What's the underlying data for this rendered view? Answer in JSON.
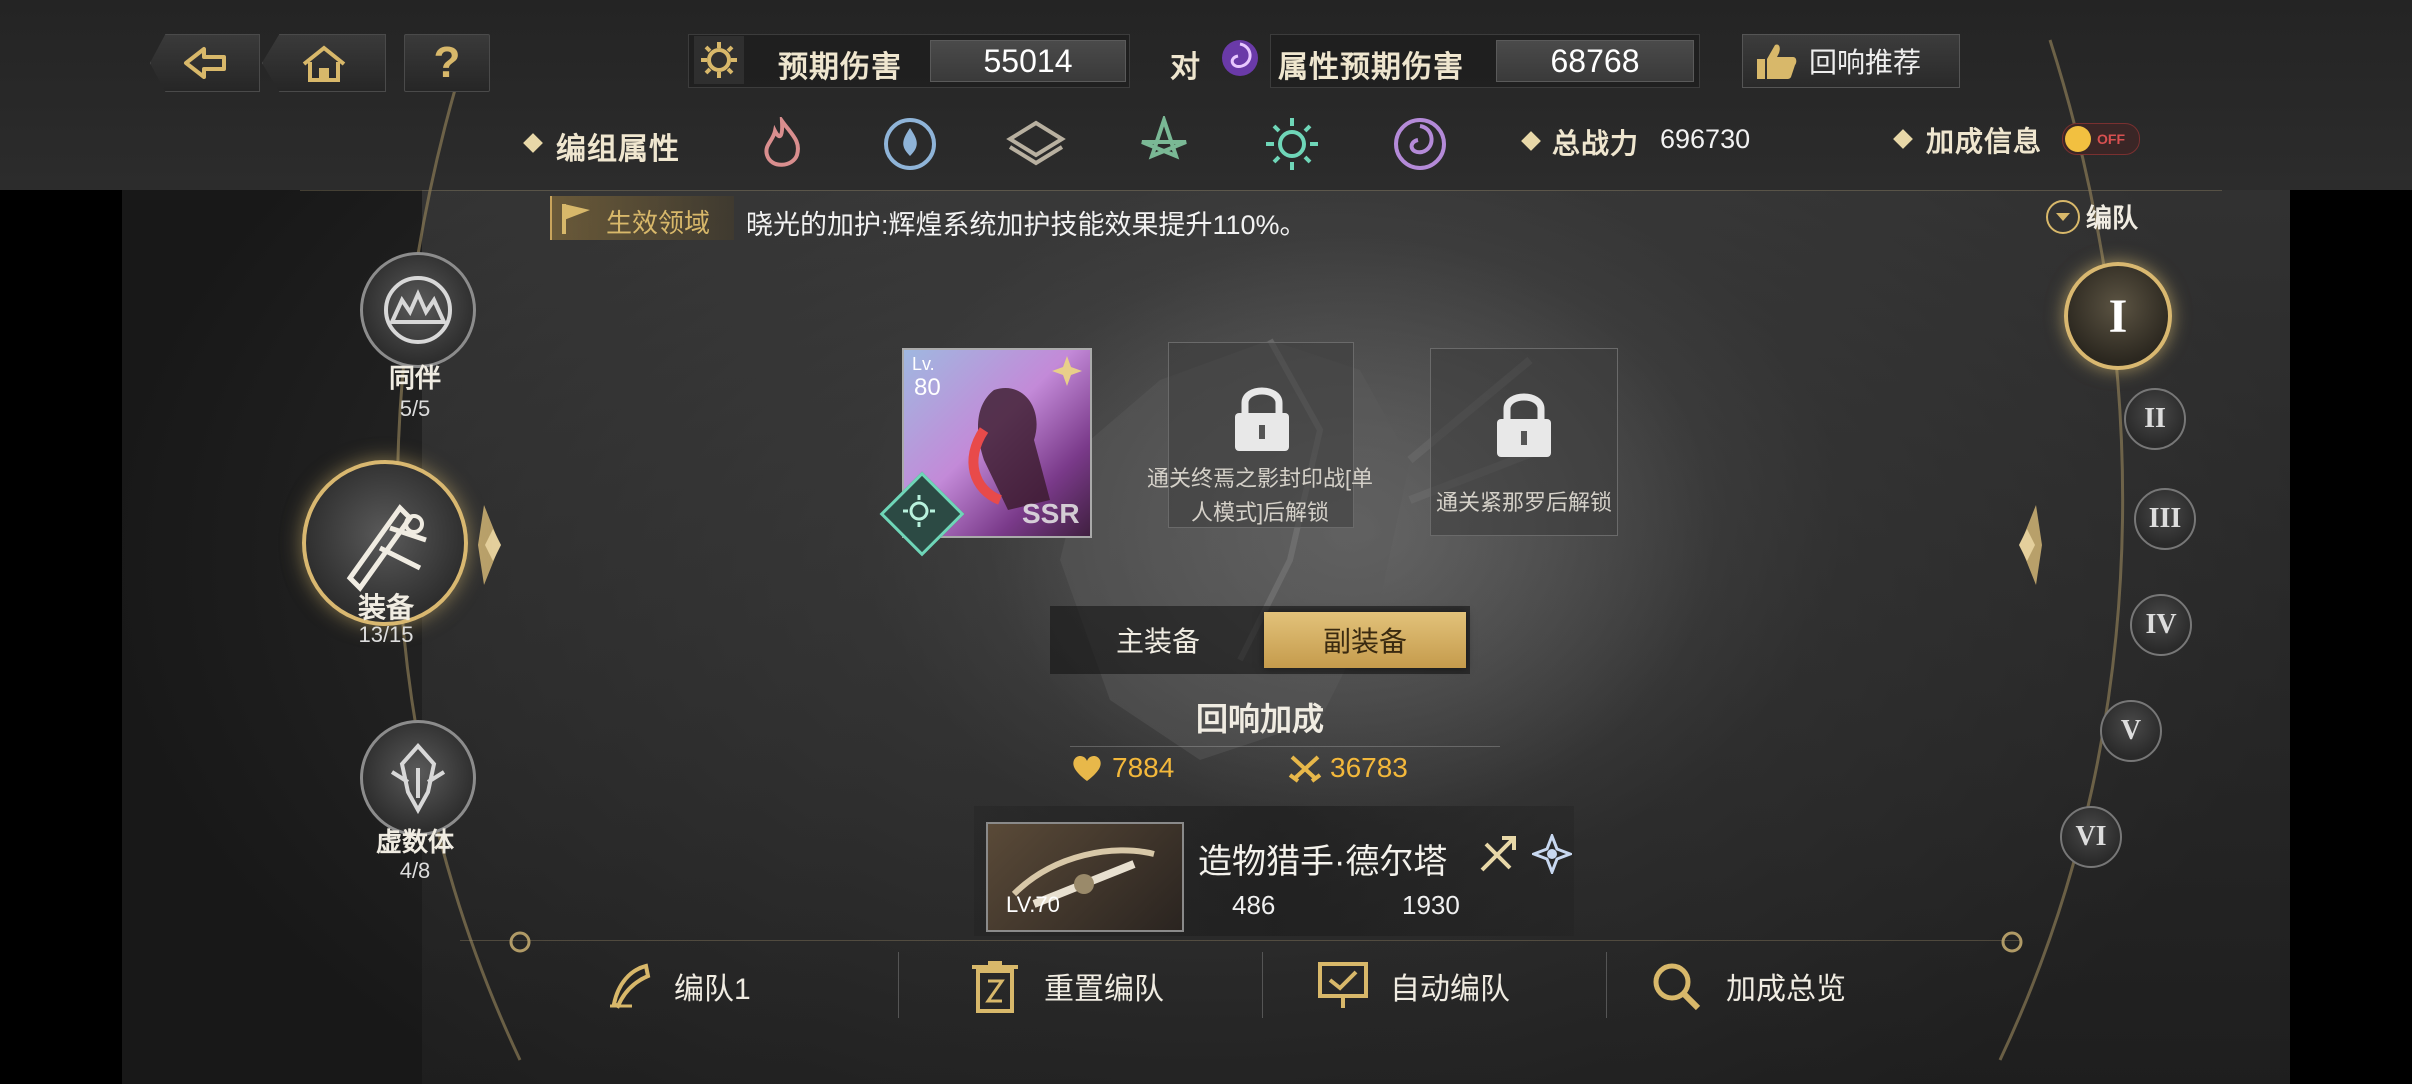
{
  "nav": {
    "back_icon": "back-arrow-icon",
    "home_icon": "home-icon",
    "help_icon": "question-icon",
    "help_glyph": "?"
  },
  "damage": {
    "expected_label": "预期伤害",
    "expected_value": "55014",
    "vs_label": "对",
    "attr_expected_label": "属性预期伤害",
    "attr_expected_value": "68768"
  },
  "recommend": {
    "label": "回响推荐"
  },
  "team_attr": {
    "label": "编组属性"
  },
  "elements": [
    "fire",
    "ice",
    "physical",
    "wind",
    "light",
    "dark"
  ],
  "total_power": {
    "label": "总战力",
    "value": "696730"
  },
  "bonus_info": {
    "label": "加成信息",
    "toggle_text": "OFF"
  },
  "domain": {
    "tag": "生效领域",
    "text": "晓光的加护:辉煌系统加护技能效果提升110%。"
  },
  "formation_toggle": {
    "label": "编队"
  },
  "side_nav": [
    {
      "label": "同伴",
      "count": "5/5"
    },
    {
      "label": "装备",
      "count": "13/15"
    },
    {
      "label": "虚数体",
      "count": "4/8"
    }
  ],
  "teams": [
    "I",
    "II",
    "III",
    "IV",
    "V",
    "VI"
  ],
  "slots": {
    "card": {
      "lv_label": "Lv.",
      "lv_value": "80",
      "rank": "SSR"
    },
    "locked_1": "通关终焉之影封印战[单人模式]后解锁",
    "locked_2": "通关紧那罗后解锁"
  },
  "tabs": {
    "main": "主装备",
    "sub": "副装备"
  },
  "echo": {
    "title": "回响加成",
    "hp": "7884",
    "atk": "36783"
  },
  "weapon": {
    "name": "造物猎手·德尔塔",
    "level": "LV.70",
    "stat1": "486",
    "stat2": "1930"
  },
  "bottom": {
    "team_name": "编队1",
    "reset": "重置编队",
    "auto": "自动编队",
    "overview": "加成总览"
  },
  "colors": {
    "gold": "#d9b870",
    "number_gold": "#f3b83b",
    "tab_active": "#d2ac5c"
  }
}
